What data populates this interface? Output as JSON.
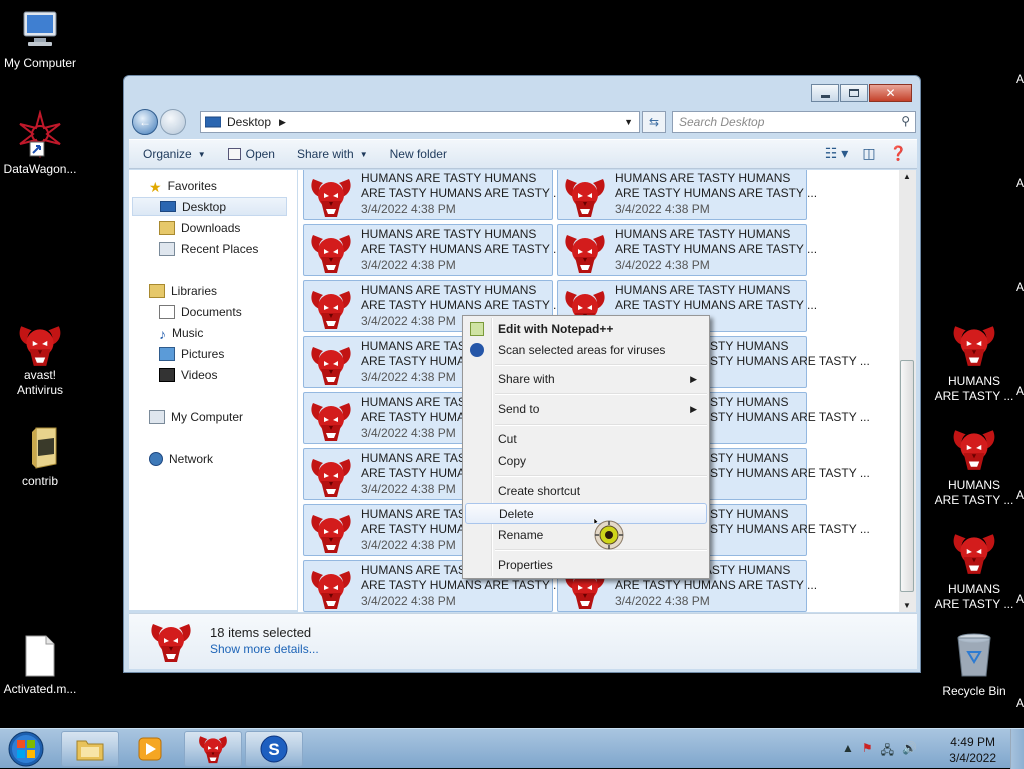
{
  "desktop": {
    "left_icons": [
      {
        "label": "My Computer",
        "icon": "computer-icon"
      },
      {
        "label": "DataWagon...",
        "icon": "datawagon-icon"
      },
      {
        "label": "avast!\nAntivirus",
        "icon": "avast-icon"
      },
      {
        "label": "contrib",
        "icon": "folder-icon"
      },
      {
        "label": "Activated.m...",
        "icon": "file-icon"
      }
    ],
    "right_icons": [
      {
        "label": "HUMANS\nARE TASTY ...",
        "icon": "horned-skull-icon"
      },
      {
        "label": "HUMANS\nARE TASTY ...",
        "icon": "horned-skull-icon"
      },
      {
        "label": "HUMANS\nARE TASTY ...",
        "icon": "horned-skull-icon"
      },
      {
        "label": "Recycle Bin",
        "icon": "recycle-bin-icon"
      }
    ],
    "edge_letter": "A"
  },
  "explorer": {
    "address": "Desktop",
    "search_placeholder": "Search Desktop",
    "commands": [
      "Organize",
      "Open",
      "Share with",
      "New folder"
    ],
    "nav": {
      "favorites": "Favorites",
      "desktop": "Desktop",
      "downloads": "Downloads",
      "recent": "Recent Places",
      "libraries": "Libraries",
      "documents": "Documents",
      "music": "Music",
      "pictures": "Pictures",
      "videos": "Videos",
      "computer": "My Computer",
      "network": "Network"
    },
    "file_tile": {
      "line1": "HUMANS ARE TASTY HUMANS",
      "line2": "ARE TASTY HUMANS ARE TASTY ...",
      "line2_cut": "ARE TASTY HUMAN",
      "line1_cut": "HUMANS ARE TAST",
      "date": "3/4/2022 4:38 PM",
      "line1_right_cut": "STY HUMANS",
      "line2_right_cut": "STY HUMANS ARE TASTY ..."
    },
    "details": {
      "count": "18 items selected",
      "more": "Show more details..."
    }
  },
  "context_menu": {
    "edit_notepad": "Edit with Notepad++",
    "scan": "Scan selected areas for viruses",
    "share_with": "Share with",
    "send_to": "Send to",
    "cut": "Cut",
    "copy": "Copy",
    "create_shortcut": "Create shortcut",
    "delete": "Delete",
    "rename": "Rename",
    "properties": "Properties"
  },
  "taskbar": {
    "time": "4:49 PM",
    "date": "3/4/2022"
  },
  "colors": {
    "skull_red": "#d31c1c",
    "selection_blue": "#d9e8f8",
    "link_blue": "#1d64b7"
  }
}
